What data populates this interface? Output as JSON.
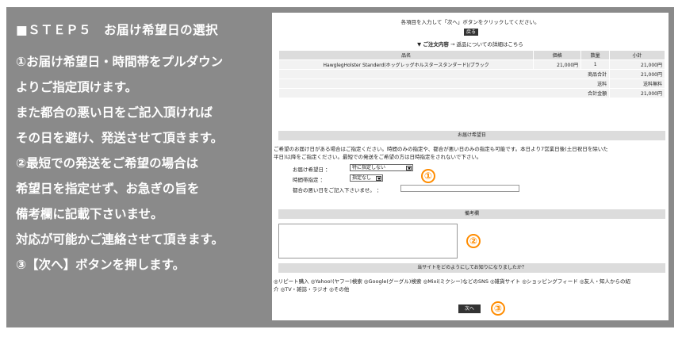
{
  "left": {
    "title": "■ＳＴＥＰ５　お届け希望日の選択",
    "lines": [
      "①お届け希望日・時間帯をプルダウン",
      "よりご指定頂けます。",
      "また都合の悪い日をご記入頂ければ",
      "その日を避け、発送させて頂きます。",
      "②最短での発送をご希望の場合は",
      "希望日を指定せず、お急ぎの旨を",
      "備考欄に記載下さいませ。",
      "対応が可能かご連絡させて頂きます。",
      "③【次へ】ボタンを押します。"
    ]
  },
  "page": {
    "instruction": "各項目を入力して「次へ」ボタンをクリックしてください。",
    "back_label": "戻る",
    "order_heading": "▼ ご注文内容",
    "order_link": "→ 返品についての詳細はこちら"
  },
  "order_table": {
    "headers": [
      "品名",
      "価格",
      "数量",
      "小計"
    ],
    "item": {
      "name": "HawglegHolster Standerd(ホッグレッグホルスタースタンダード)/ブラック",
      "price": "21,000円",
      "qty": "1",
      "subtotal": "21,000円"
    },
    "summary": [
      {
        "label": "商品合計",
        "value": "21,000円"
      },
      {
        "label": "送料",
        "value": "送料無料"
      },
      {
        "label": "合計金額",
        "value": "21,000円"
      }
    ]
  },
  "delivery": {
    "heading": "お届け希望日",
    "note_line1": "ご希望のお届け日がある場合はご指定ください。時間のみの指定や、都合が悪い日のみの指定も可能です。本日より7営業日後(土日祝日を除いた",
    "note_line2": "平日)以降をご指定ください。最短での発送をご希望の方は日時指定をされないで下さい。",
    "date_label": "お届け希望日 ：",
    "date_value": "特に指定しない",
    "time_label": "時間帯指定 ：",
    "time_value": "指定なし",
    "bad_day_label": "都合の悪い日をご記入下さいませ。 ："
  },
  "remarks": {
    "heading": "備考欄"
  },
  "survey": {
    "question": "当サイトをどのようにしてお知りになりましたか？",
    "options_line1": "◎リピート購入 ◎Yahoo!(ヤフー)検索 ◎Google(グーグル)検索 ◎Mixi(ミクシー)などのSNS ◎雑貨サイト ◎ショッピングフィード ◎友人・知人からの紹",
    "options_line2": "介 ◎TV・雑誌・ラジオ ◎その他"
  },
  "next_label": "次へ",
  "markers": {
    "one": "①",
    "two": "②",
    "three": "③"
  }
}
